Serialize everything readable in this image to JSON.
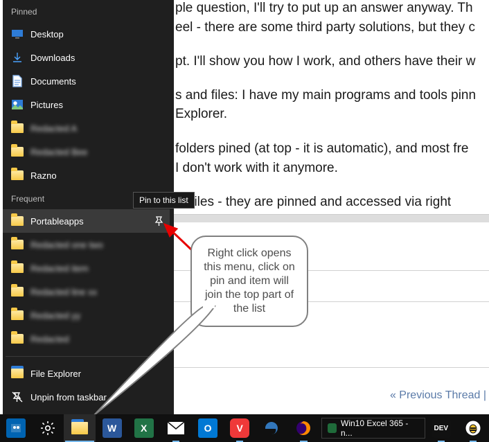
{
  "background": {
    "line1a": "ple question, I'll try to put up an answer anyway. Th",
    "line1b": "eel - there are some third party solutions, but they c",
    "line2": "pt. I'll show you how I work, and others have their w",
    "line3a": "s and files: I have my main programs and tools pinn",
    "line3b": "Explorer.",
    "line4a": "folders pined (at top - it is automatic), and most fre",
    "line4b": "I don't work with it anymore.",
    "line5": "rd files - they are pinned and accessed via right",
    "prev_thread": "« Previous Thread  |"
  },
  "jumplist": {
    "section_pinned": "Pinned",
    "section_frequent": "Frequent",
    "pinned": [
      {
        "icon": "desktop",
        "label": "Desktop"
      },
      {
        "icon": "download",
        "label": "Downloads"
      },
      {
        "icon": "document",
        "label": "Documents"
      },
      {
        "icon": "pictures",
        "label": "Pictures"
      },
      {
        "icon": "folder",
        "label": "Redacted A",
        "blurred": true
      },
      {
        "icon": "folder",
        "label": "Redacted Bee",
        "blurred": true
      },
      {
        "icon": "folder",
        "label": "Razno"
      }
    ],
    "frequent": [
      {
        "icon": "folder",
        "label": "Portableapps",
        "hover": true,
        "show_pin": true
      },
      {
        "icon": "folder",
        "label": "Redacted one two",
        "blurred": true
      },
      {
        "icon": "folder",
        "label": "Redacted item",
        "blurred": true
      },
      {
        "icon": "folder",
        "label": "Redacted line xx",
        "blurred": true
      },
      {
        "icon": "folder",
        "label": "Redacted yy",
        "blurred": true
      },
      {
        "icon": "folder",
        "label": "Redacted",
        "blurred": true
      }
    ],
    "footer": {
      "file_explorer": "File Explorer",
      "unpin": "Unpin from taskbar"
    },
    "tooltip": "Pin to this list"
  },
  "callout": {
    "text": "Right click opens this menu, click on pin and item will join the top part of the list"
  },
  "taskbar": {
    "window_title": "Win10 Excel 365 - n..."
  }
}
